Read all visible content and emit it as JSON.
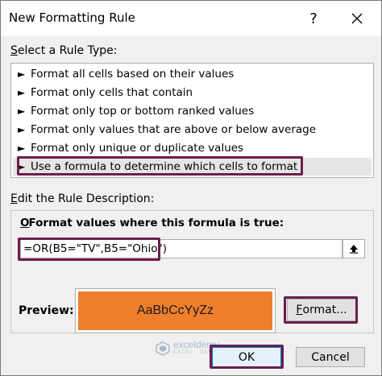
{
  "window": {
    "title": "New Formatting Rule",
    "help_glyph": "?",
    "close_icon": "close-icon"
  },
  "rule_type": {
    "label_prefix": "S",
    "label_rest": "elect a Rule Type:",
    "items": [
      {
        "label": "Format all cells based on their values"
      },
      {
        "label": "Format only cells that contain"
      },
      {
        "label": "Format only top or bottom ranked values"
      },
      {
        "label": "Format only values that are above or below average"
      },
      {
        "label": "Format only unique or duplicate values"
      },
      {
        "label": "Use a formula to determine which cells to format"
      }
    ],
    "selected_index": 5,
    "arrow_glyph": "►"
  },
  "description": {
    "label_prefix": "E",
    "label_rest": "dit the Rule Description:",
    "formula_label_prefix": "O",
    "formula_label_rest": "Format values where this formula is true:",
    "formula_value": "=OR(B5=\"TV\",B5=\"Ohio\")",
    "preview_label": "Preview:",
    "preview_sample": "AaBbCcYyZz",
    "preview_color": "#f07f2d",
    "format_button_prefix": "F",
    "format_button_rest": "ormat..."
  },
  "footer": {
    "ok_label": "OK",
    "cancel_label": "Cancel",
    "watermark_name": "exceldemy",
    "watermark_tag": "EXCEL · DATA · BI"
  }
}
